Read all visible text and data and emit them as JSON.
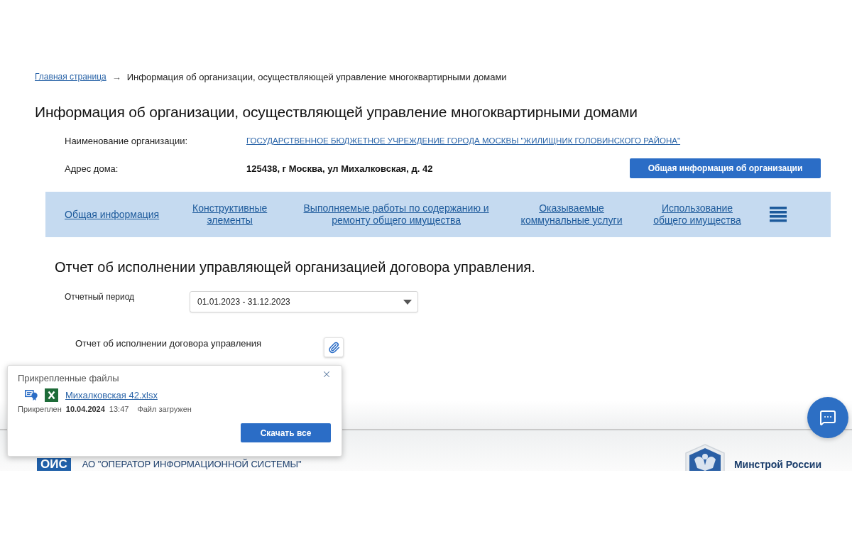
{
  "breadcrumb": {
    "home": "Главная страница",
    "separator": "→",
    "current": "Информация об организации, осуществляющей управление многоквартирными домами"
  },
  "page_title": "Информация об организации, осуществляющей управление многоквартирными домами",
  "organization": {
    "fields": [
      {
        "kind": "link",
        "label": "Наименование организации:",
        "value": "ГОСУДАРСТВЕННОЕ БЮДЖЕТНОЕ УЧРЕЖДЕНИЕ ГОРОДА МОСКВЫ \"ЖИЛИЩНИК ГОЛОВИНСКОГО РАЙОНА\""
      },
      {
        "kind": "text",
        "label": "Адрес дома:",
        "value": "125438, г Москва, ул Михалковская, д. 42"
      }
    ],
    "button": "Общая информация об организации"
  },
  "nav": {
    "items": [
      "Общая информация",
      "Конструктивные элементы",
      "Выполняемые работы по содержанию и ремонту общего имущества",
      "Оказываемые коммунальные услуги",
      "Использование общего имущества"
    ]
  },
  "report": {
    "title": "Отчет об исполнении управляющей организацией договора управления.",
    "period": {
      "label": "Отчетный период",
      "value": "01.01.2023 - 31.12.2023"
    },
    "document": {
      "label": "Отчет об исполнении договора управления"
    }
  },
  "attachments": {
    "title": "Прикрепленные файлы",
    "files": [
      {
        "name": "Михалковская 42.xlsx",
        "attached_label": "Прикреплен",
        "date": "10.04.2024",
        "time": "13:47",
        "status": "Файл загружен"
      }
    ],
    "button": "Скачать все"
  },
  "footer": {
    "operator_logo": "ОИС",
    "operator_name": "АО \"ОПЕРАТОР ИНФОРМАЦИОННОЙ СИСТЕМЫ\"",
    "ministry": "Минстрой России"
  }
}
